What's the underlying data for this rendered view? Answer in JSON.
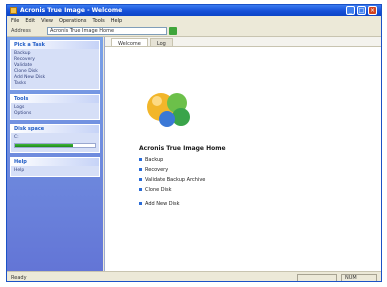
{
  "window": {
    "title": "Acronis True Image - Welcome",
    "buttons": [
      "_",
      "□",
      "×"
    ]
  },
  "menubar": {
    "items": [
      "File",
      "Edit",
      "View",
      "Operations",
      "Tools",
      "Help"
    ]
  },
  "addressbar": {
    "label": "Address",
    "value": "Acronis True Image Home"
  },
  "sidebar": {
    "panels": [
      {
        "title": "Pick a Task",
        "rows": [
          {
            "label": "Backup",
            "value": ""
          },
          {
            "label": "Recovery",
            "value": ""
          },
          {
            "label": "Validate",
            "value": ""
          },
          {
            "label": "Clone Disk",
            "value": ""
          },
          {
            "label": "Add New Disk",
            "value": ""
          },
          {
            "label": "Tasks",
            "value": ""
          }
        ]
      },
      {
        "title": "Tools",
        "rows": [
          {
            "label": "Logs",
            "value": ""
          },
          {
            "label": "Options",
            "value": ""
          }
        ]
      },
      {
        "title": "Disk space",
        "rows": [
          {
            "label": "C:",
            "value": ""
          }
        ],
        "progress": 0.72
      },
      {
        "title": "Help",
        "rows": [
          {
            "label": "Help",
            "value": ""
          }
        ]
      }
    ]
  },
  "content": {
    "tabs": [
      "Welcome",
      "Log"
    ],
    "section_title": "Acronis True Image Home",
    "items": [
      {
        "label": "Backup",
        "note": ""
      },
      {
        "label": "Recovery",
        "note": ""
      },
      {
        "label": "Validate Backup Archive",
        "note": ""
      },
      {
        "label": "Clone Disk",
        "note": ""
      },
      {
        "label": "Add New Disk",
        "note": ""
      }
    ]
  },
  "statusbar": {
    "text": "Ready",
    "cells": [
      "",
      "NUM"
    ]
  },
  "colors": {
    "accent": "#215dc6",
    "titlebar": "#1650d8",
    "sidebar": "#6f8ce0"
  },
  "icons": {
    "app": "app-icon",
    "logo": "logo-icon"
  }
}
